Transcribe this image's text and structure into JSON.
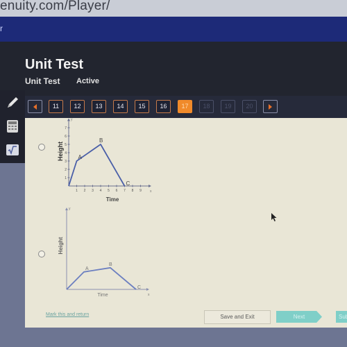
{
  "browser": {
    "url_fragment": "enuity.com/Player/"
  },
  "navband": {
    "fragment": "r"
  },
  "header": {
    "title": "Unit Test",
    "subtitle": "Unit Test",
    "status": "Active"
  },
  "toolbar": {
    "prev_icon": "triangle-left-icon",
    "next_icon": "triangle-right-icon",
    "questions": [
      {
        "label": "11",
        "state": "answered"
      },
      {
        "label": "12",
        "state": "answered"
      },
      {
        "label": "13",
        "state": "answered"
      },
      {
        "label": "14",
        "state": "answered"
      },
      {
        "label": "15",
        "state": "answered"
      },
      {
        "label": "16",
        "state": "answered"
      },
      {
        "label": "17",
        "state": "current"
      },
      {
        "label": "18",
        "state": "disabled"
      },
      {
        "label": "19",
        "state": "disabled"
      },
      {
        "label": "20",
        "state": "disabled"
      }
    ],
    "accent_color": "#f08a2a"
  },
  "side_tools": [
    {
      "name": "pencil-icon"
    },
    {
      "name": "calculator-icon"
    },
    {
      "name": "formula-sheet-icon"
    }
  ],
  "options": [
    {
      "graph": {
        "y_label": "Height",
        "x_label": "Time",
        "y_axis_symbol": "y",
        "x_axis_symbol": "x",
        "x_ticks": [
          "1",
          "2",
          "3",
          "4",
          "5",
          "6",
          "7",
          "8",
          "9"
        ],
        "y_ticks": [
          "1",
          "2",
          "3",
          "4",
          "5",
          "6",
          "7"
        ],
        "points": [
          {
            "label": "",
            "x": 0,
            "y": 0
          },
          {
            "label": "A",
            "x": 1,
            "y": 3
          },
          {
            "label": "B",
            "x": 4,
            "y": 5
          },
          {
            "label": "C",
            "x": 7,
            "y": 0
          }
        ]
      }
    },
    {
      "graph": {
        "y_label": "Height",
        "x_label": "Time",
        "y_axis_symbol": "y",
        "x_axis_symbol": "x",
        "points": [
          {
            "label": "",
            "x": 0,
            "y": 0
          },
          {
            "label": "A",
            "x": 2.5,
            "y": 2.1
          },
          {
            "label": "B",
            "x": 6.3,
            "y": 2.6
          },
          {
            "label": "C",
            "x": 10,
            "y": 0
          }
        ]
      }
    }
  ],
  "footer": {
    "mark_link": "Mark this and return",
    "save_exit": "Save and Exit",
    "next": "Next",
    "submit": "Submit"
  }
}
